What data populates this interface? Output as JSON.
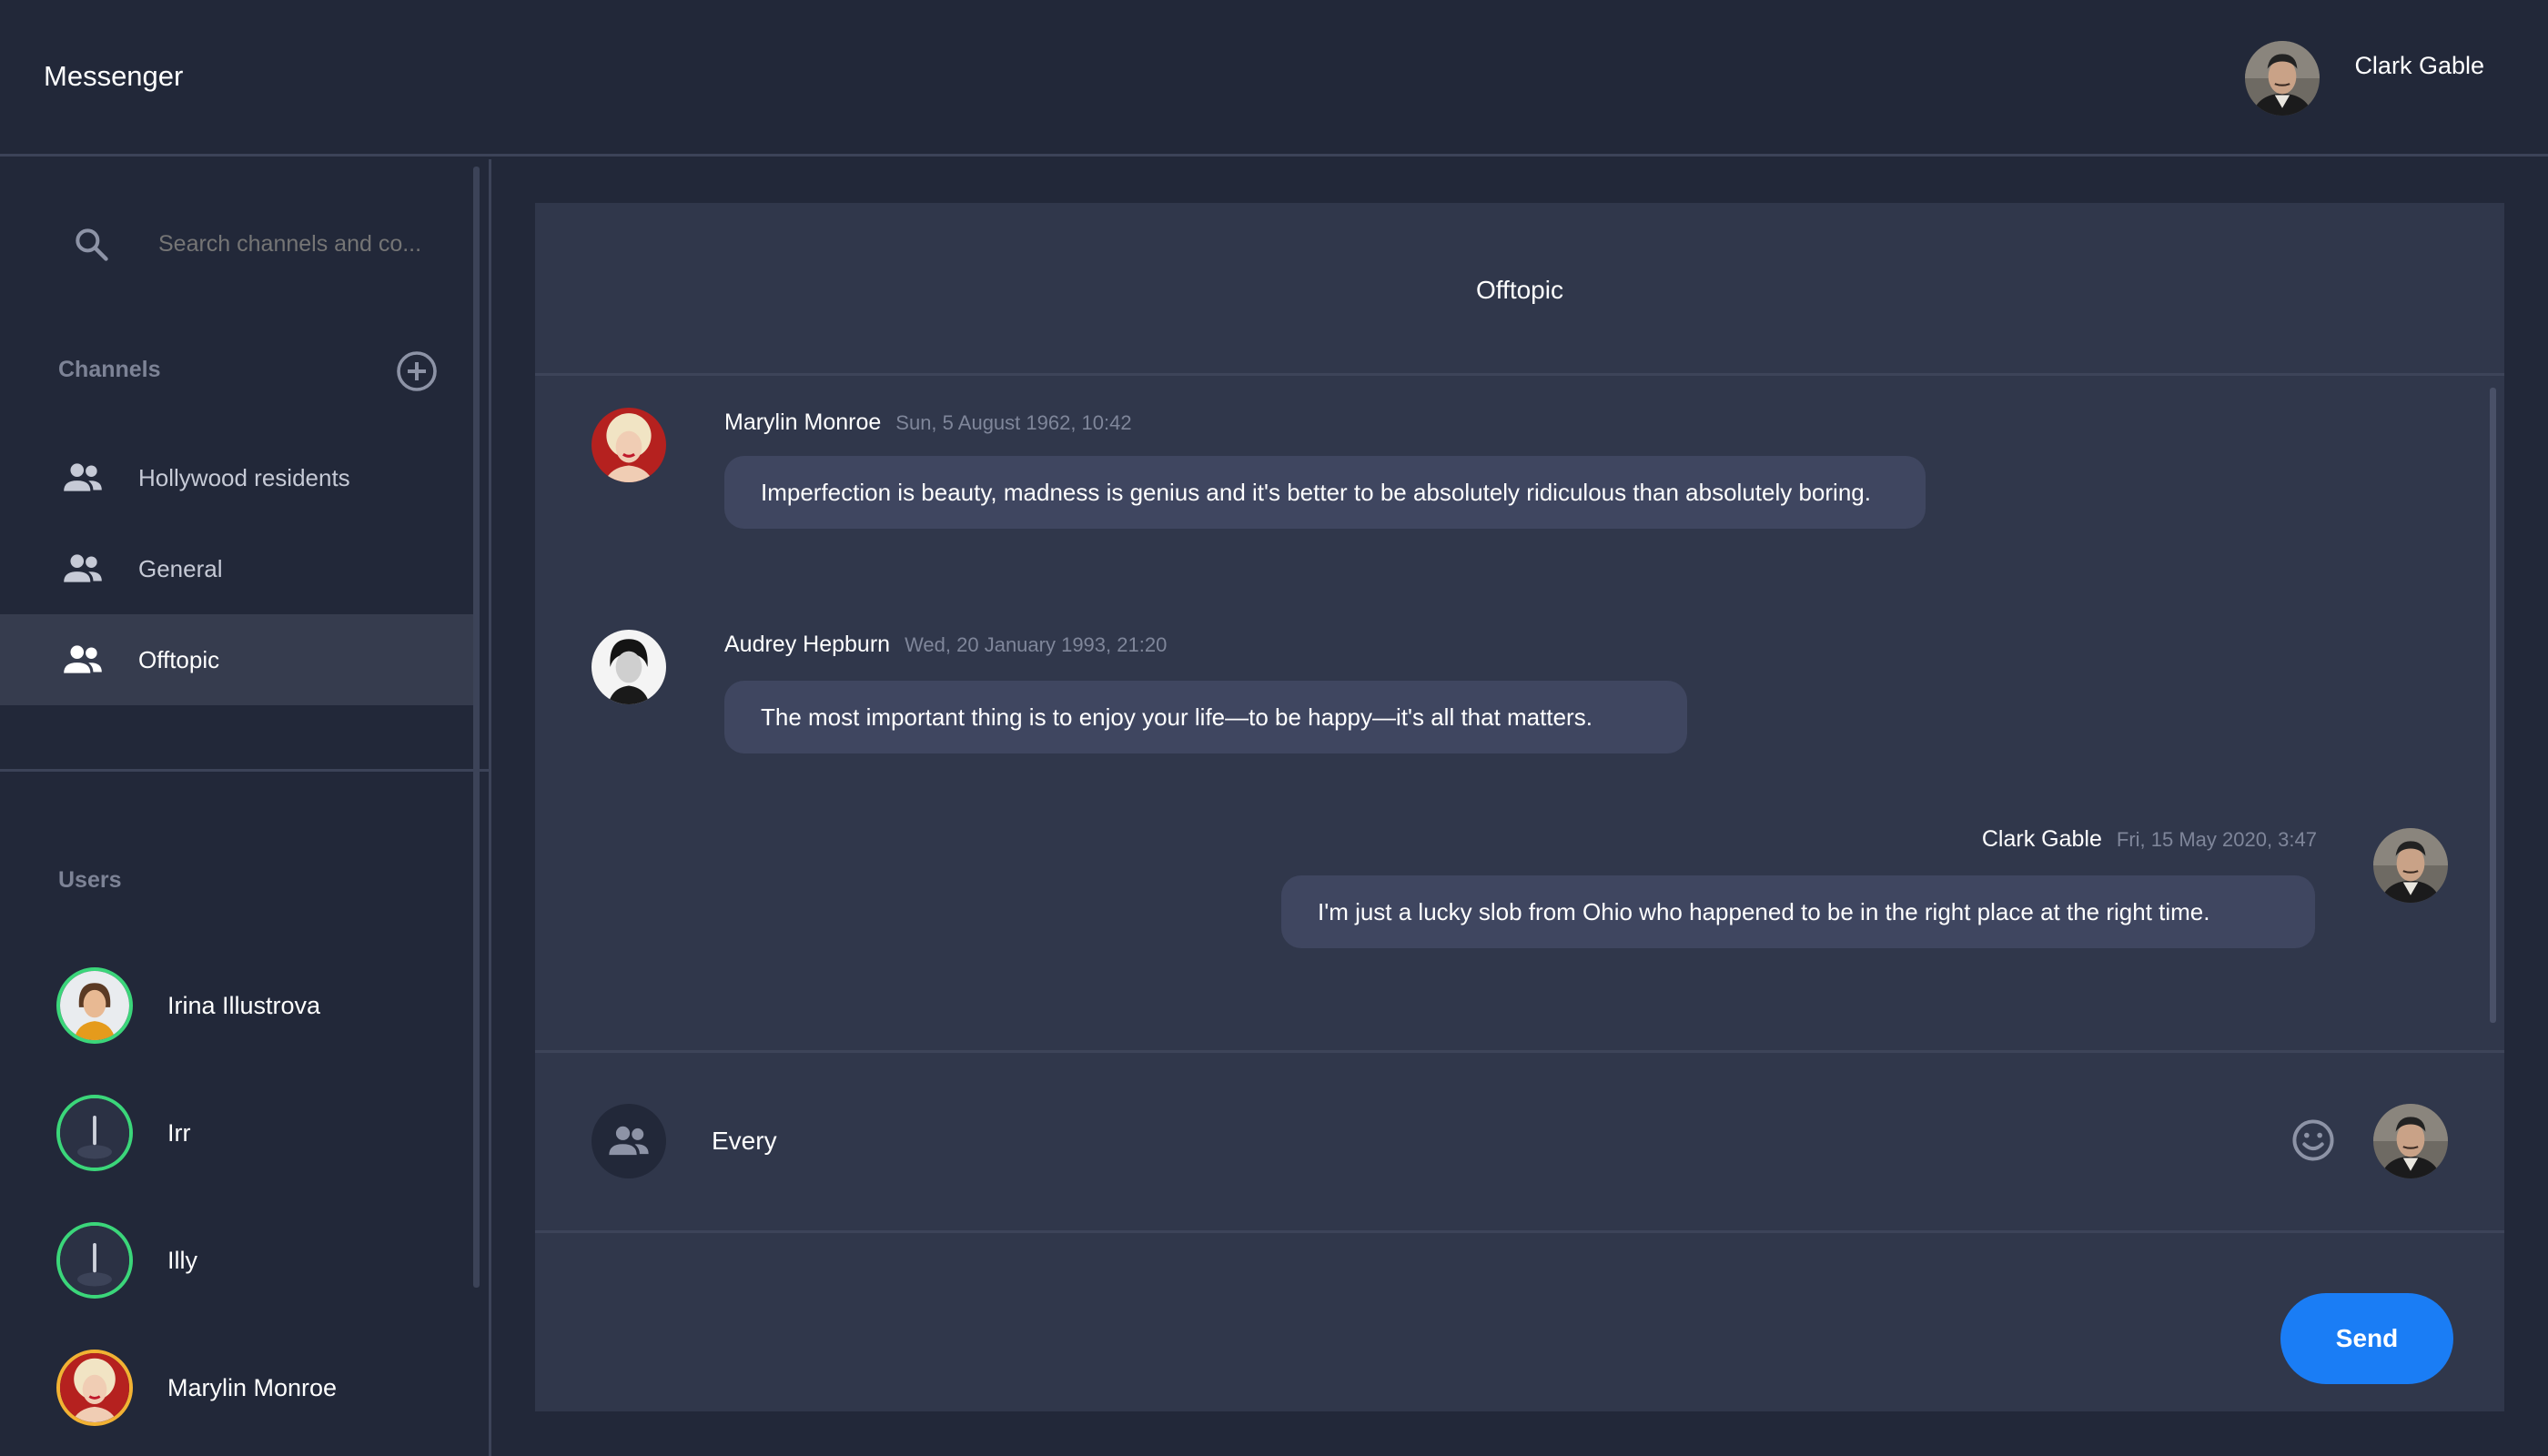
{
  "app": {
    "title": "Messenger",
    "current_user": {
      "name": "Clark Gable",
      "avatar": "clark-gable-photo"
    }
  },
  "sidebar": {
    "search": {
      "placeholder": "Search channels and co...",
      "icon": "search-icon"
    },
    "channels_heading": "Channels",
    "add_channel_icon": "plus-circle-icon",
    "channels": [
      {
        "label": "Hollywood residents",
        "icon": "group-icon",
        "active": false
      },
      {
        "label": "General",
        "icon": "group-icon",
        "active": false
      },
      {
        "label": "Offtopic",
        "icon": "group-icon",
        "active": true
      }
    ],
    "users_heading": "Users",
    "users": [
      {
        "name": "Irina Illustrova",
        "status": "online",
        "ring_color": "#3bd67a"
      },
      {
        "name": "Irr",
        "status": "online",
        "ring_color": "#3bd67a"
      },
      {
        "name": "Illy",
        "status": "online",
        "ring_color": "#3bd67a"
      },
      {
        "name": "Marylin Monroe",
        "status": "away",
        "ring_color": "#f2b233"
      }
    ]
  },
  "chat": {
    "title": "Offtopic",
    "messages": [
      {
        "author": "Marylin Monroe",
        "timestamp": "Sun, 5 August 1962, 10:42",
        "text": "Imperfection is beauty, madness is genius and it's better to be absolutely ridiculous than absolutely boring.",
        "own": false
      },
      {
        "author": "Audrey Hepburn",
        "timestamp": "Wed, 20 January 1993, 21:20",
        "text": "The most important thing is to enjoy your life—to be happy—it's all that matters.",
        "own": false
      },
      {
        "author": "Clark Gable",
        "timestamp": "Fri, 15 May 2020, 3:47",
        "text": "I'm just a lucky slob from Ohio who happened to be in the right place at the right time.",
        "own": true
      }
    ],
    "composer": {
      "value": "Every",
      "target_icon": "group-icon",
      "emoji_icon": "smiley-icon",
      "send_label": "Send"
    }
  },
  "colors": {
    "background": "#222839",
    "panel": "#30374b",
    "bubble": "#3f4660",
    "accent": "#1a7df5",
    "online": "#3bd67a",
    "away": "#f2b233"
  }
}
